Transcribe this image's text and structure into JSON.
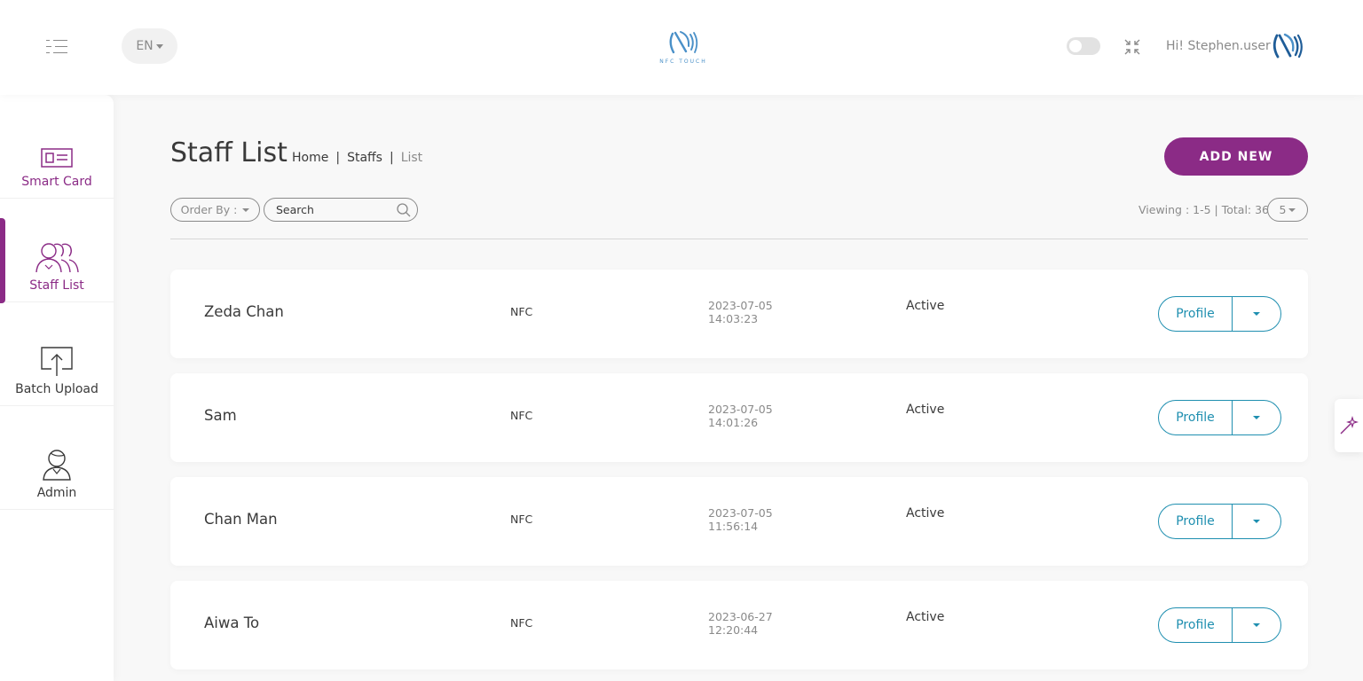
{
  "header": {
    "language": "EN",
    "logo_text": "NFC TOUCH",
    "greeting": "Hi! Stephen.user"
  },
  "sidebar": {
    "items": [
      {
        "label": "Smart Card",
        "icon": "id-card-icon"
      },
      {
        "label": "Staff List",
        "icon": "staff-group-icon",
        "active": true
      },
      {
        "label": "Batch Upload",
        "icon": "upload-icon"
      },
      {
        "label": "Admin",
        "icon": "admin-user-icon"
      }
    ]
  },
  "main": {
    "title": "Staff List",
    "breadcrumb": {
      "home": "Home",
      "section": "Staffs",
      "current": "List"
    },
    "add_button": "ADD NEW",
    "order_by": "Order By :",
    "search_placeholder": "Search",
    "viewing": "Viewing : 1-5 | Total: 36",
    "page_size": "5"
  },
  "staff": [
    {
      "name": "Zeda Chan",
      "type": "NFC",
      "date": "2023-07-05",
      "time": "14:03:23",
      "status": "Active",
      "action": "Profile"
    },
    {
      "name": "Sam",
      "type": "NFC",
      "date": "2023-07-05",
      "time": "14:01:26",
      "status": "Active",
      "action": "Profile"
    },
    {
      "name": "Chan Man",
      "type": "NFC",
      "date": "2023-07-05",
      "time": "11:56:14",
      "status": "Active",
      "action": "Profile"
    },
    {
      "name": "Aiwa To",
      "type": "NFC",
      "date": "2023-06-27",
      "time": "12:20:44",
      "status": "Active",
      "action": "Profile"
    }
  ],
  "colors": {
    "accent": "#8b2b86",
    "link": "#1f8fb0",
    "logo": "#4a90c8"
  }
}
